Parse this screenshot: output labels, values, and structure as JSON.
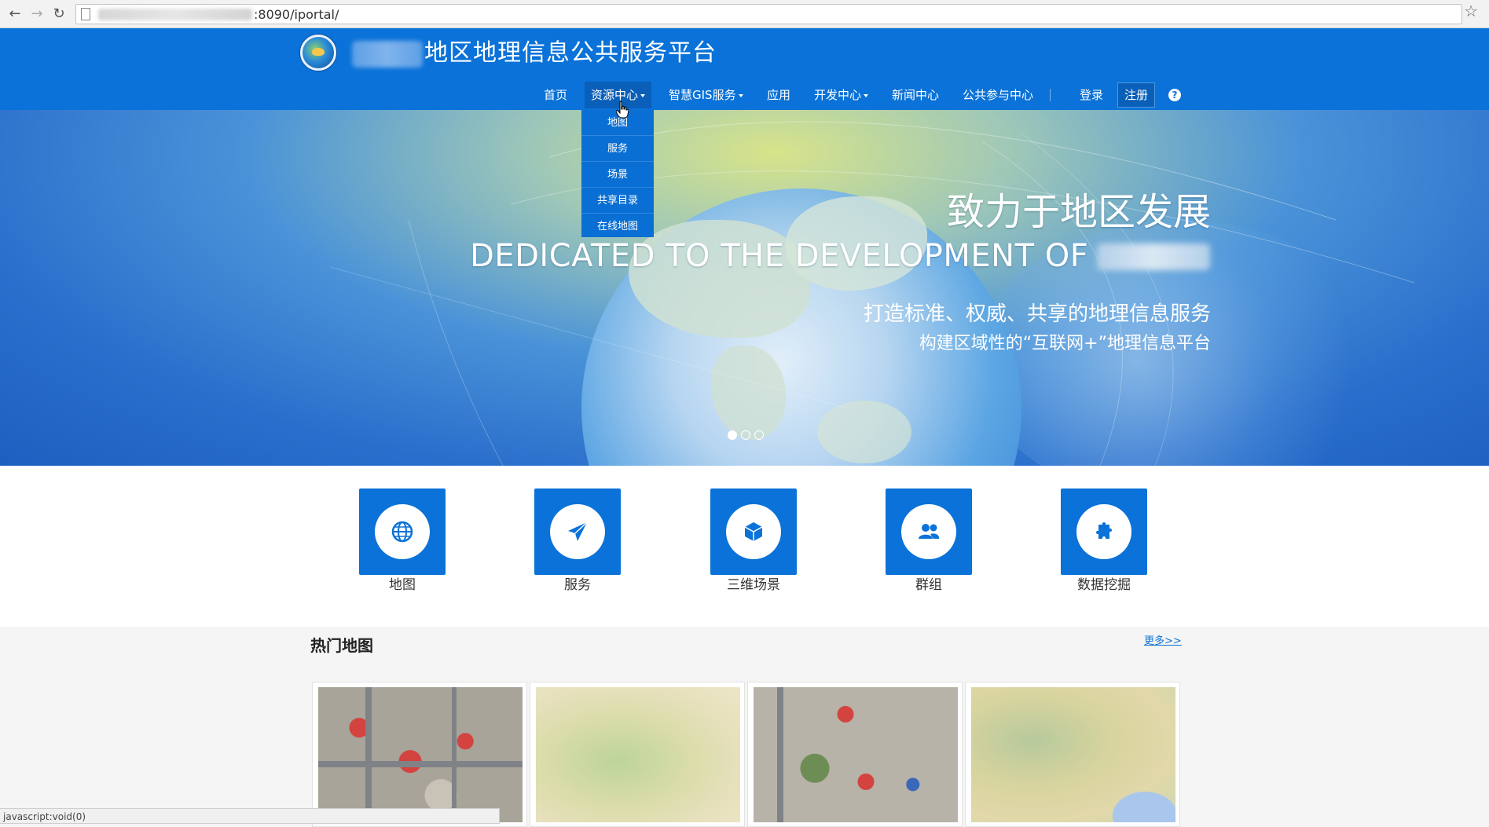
{
  "browser": {
    "url": ":8090/iportal/",
    "status_text": "javascript:void(0)"
  },
  "header": {
    "site_title": "地区地理信息公共服务平台"
  },
  "nav": {
    "home": "首页",
    "resources": "资源中心",
    "smart_gis": "智慧GIS服务",
    "apps": "应用",
    "dev_center": "开发中心",
    "news": "新闻中心",
    "public": "公共参与中心",
    "login": "登录",
    "register": "注册",
    "help": "?"
  },
  "dropdown": {
    "items": [
      "地图",
      "服务",
      "场景",
      "共享目录",
      "在线地图"
    ]
  },
  "banner": {
    "title": "致力于地区发展",
    "subtitle": "DEDICATED TO THE DEVELOPMENT OF",
    "tag1": "打造标准、权威、共享的地理信息服务",
    "tag2": "构建区域性的“互联网+”地理信息平台",
    "slides": 3,
    "active_slide": 1
  },
  "tiles": [
    {
      "label": "地图",
      "icon": "globe-icon"
    },
    {
      "label": "服务",
      "icon": "paper-plane-icon"
    },
    {
      "label": "三维场景",
      "icon": "cube-icon"
    },
    {
      "label": "群组",
      "icon": "users-icon"
    },
    {
      "label": "数据挖掘",
      "icon": "puzzle-icon"
    }
  ],
  "hot_maps": {
    "title": "热门地图",
    "more": "更多>>"
  },
  "colors": {
    "brand": "#0a72d8",
    "brand_dark": "#0a5fb8"
  }
}
